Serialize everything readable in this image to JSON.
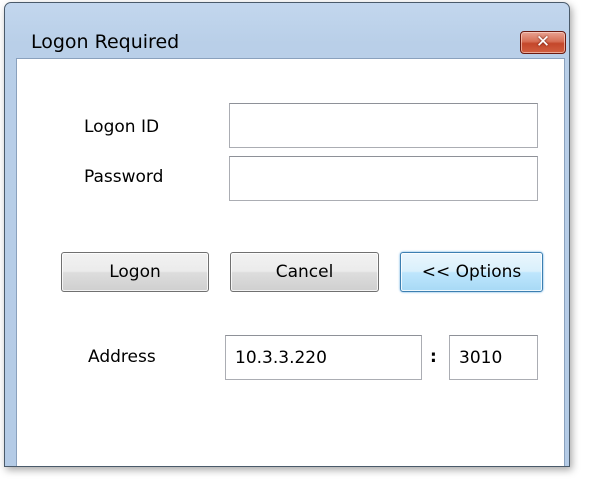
{
  "window": {
    "title": "Logon Required",
    "close_icon": "✕"
  },
  "form": {
    "logon_id_label": "Logon ID",
    "logon_id_value": "",
    "password_label": "Password",
    "password_value": ""
  },
  "buttons": {
    "logon_label": "Logon",
    "cancel_label": "Cancel",
    "options_label": "<< Options"
  },
  "address": {
    "label": "Address",
    "host_value": "10.3.3.220",
    "separator": ":",
    "port_value": "3010"
  },
  "colors": {
    "title_bar": "#b9cfe8",
    "close_button": "#d15f40",
    "focused_button": "#bee6fd"
  }
}
